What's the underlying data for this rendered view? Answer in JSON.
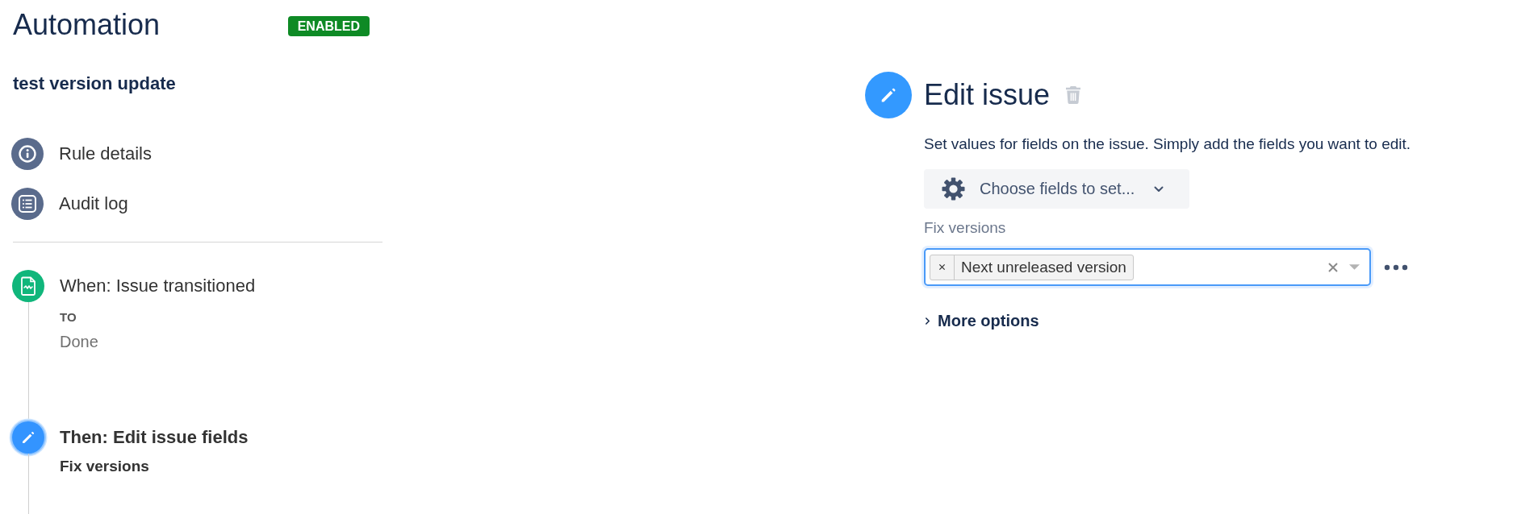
{
  "header": {
    "title": "Automation",
    "badge": "ENABLED"
  },
  "rule_name": "test version update",
  "nav": [
    {
      "kind": "info",
      "label": "Rule details"
    },
    {
      "kind": "log",
      "label": "Audit log"
    }
  ],
  "steps": [
    {
      "kind": "trigger",
      "title": "When: Issue transitioned",
      "selected": false,
      "details": [
        {
          "kind": "caption",
          "text": "TO"
        },
        {
          "kind": "value",
          "text": "Done"
        }
      ]
    },
    {
      "kind": "action",
      "title": "Then: Edit issue fields",
      "selected": true,
      "details": [
        {
          "kind": "field",
          "text": "Fix versions"
        }
      ]
    }
  ],
  "editor": {
    "title": "Edit issue",
    "description": "Set values for fields on the issue. Simply add the fields you want to edit.",
    "choose_button": "Choose fields to set...",
    "fields": [
      {
        "label": "Fix versions",
        "focused": true,
        "values": [
          "Next unreleased version"
        ]
      }
    ],
    "more_options": {
      "label": "More options",
      "expanded": false
    }
  }
}
